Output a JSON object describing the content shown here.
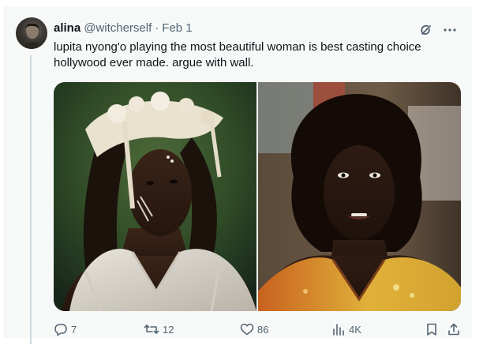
{
  "tweet": {
    "author_name": "alina",
    "author_handle": "@witcherself",
    "separator": "·",
    "date": "Feb 1",
    "text": "lupita nyong'o playing the most beautiful woman is best casting choice hollywood ever made. argue with wall."
  },
  "media": {
    "image_count": 2
  },
  "actions": {
    "replies": "7",
    "retweets": "12",
    "likes": "86",
    "views": "4K"
  },
  "icons": {
    "grok": "grok-icon",
    "more": "more-icon",
    "reply": "reply-icon",
    "retweet": "retweet-icon",
    "like": "heart-icon",
    "views": "views-icon",
    "bookmark": "bookmark-icon",
    "share": "share-icon"
  },
  "colors": {
    "text_primary": "#0f1419",
    "text_secondary": "#536471",
    "background": "#f7f9f9"
  }
}
